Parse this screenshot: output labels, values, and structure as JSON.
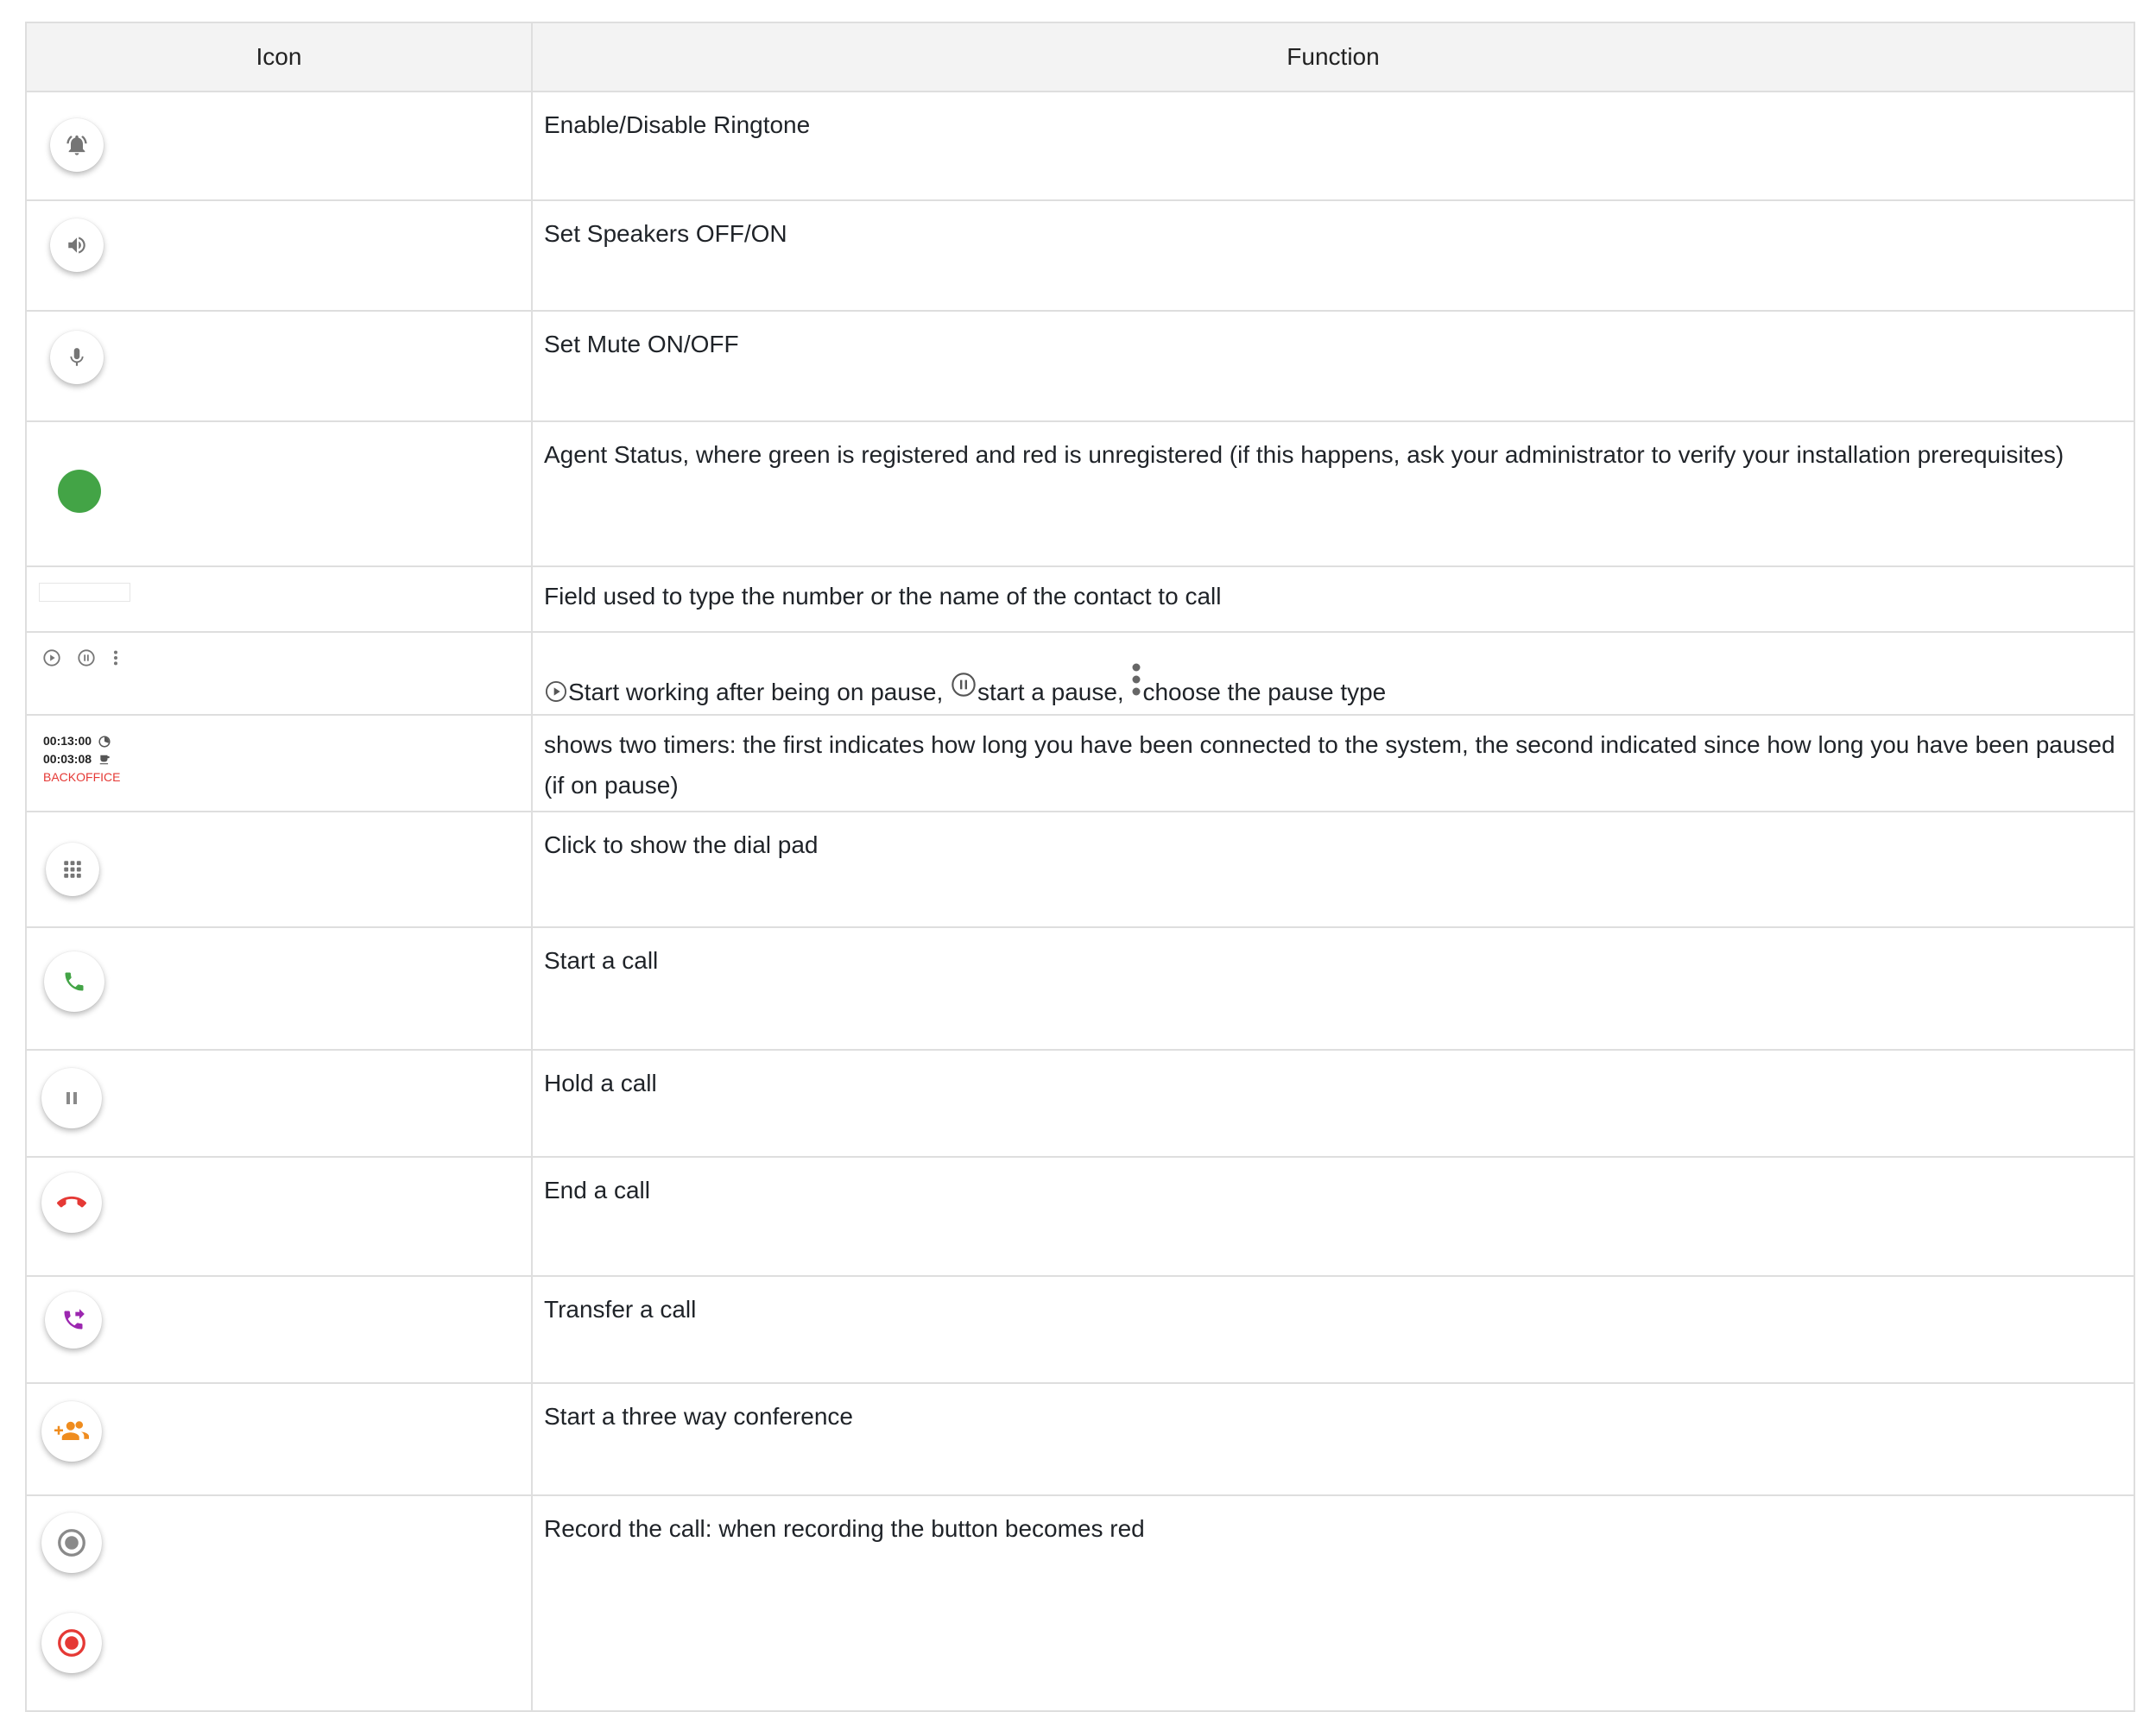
{
  "table": {
    "headers": {
      "icon": "Icon",
      "function": "Function"
    },
    "rows": {
      "ringtone": {
        "icon": "bell-icon",
        "function": "Enable/Disable Ringtone"
      },
      "speakers": {
        "icon": "speaker-icon",
        "function": "Set Speakers OFF/ON"
      },
      "mute": {
        "icon": "microphone-icon",
        "function": "Set Mute ON/OFF"
      },
      "agent_status": {
        "icon": "status-dot",
        "status_color": "#43a446",
        "function": "Agent Status, where green is registered and red is unregistered (if this happens, ask your administrator to verify your installation prerequisites)"
      },
      "search_field": {
        "function": "Field used to type the number or the name of the contact to call"
      },
      "pause_controls": {
        "icons": [
          "play-circle-icon",
          "pause-circle-icon",
          "more-vert-icon"
        ],
        "part1": "Start working after being on pause,",
        "part2": "start a pause,",
        "part3": "choose the pause type"
      },
      "timers": {
        "timer_connected": "00:13:00",
        "timer_paused": "00:03:08",
        "state": "BACKOFFICE",
        "state_color": "#e53935",
        "function": "shows two timers: the first indicates how long you have been connected to the system, the second indicated since how long you have been paused (if on pause)"
      },
      "dialpad": {
        "icon": "dialpad-icon",
        "function": "Click to show the dial pad"
      },
      "start_call": {
        "icon": "phone-icon",
        "icon_color": "#43a446",
        "function": "Start a call"
      },
      "hold_call": {
        "icon": "pause-icon",
        "function": "Hold a call"
      },
      "end_call": {
        "icon": "call-end-icon",
        "icon_color": "#e53935",
        "function": "End a call"
      },
      "transfer_call": {
        "icon": "phone-forwarded-icon",
        "icon_color": "#9c27b0",
        "function": "Transfer a call"
      },
      "conference": {
        "icon": "group-add-icon",
        "icon_color": "#ef8c1e",
        "function": "Start a three way conference"
      },
      "record": {
        "icons": [
          "record-off-icon",
          "record-on-icon"
        ],
        "recording_color": "#e53935",
        "function": "Record the call: when recording the button becomes red"
      }
    }
  }
}
